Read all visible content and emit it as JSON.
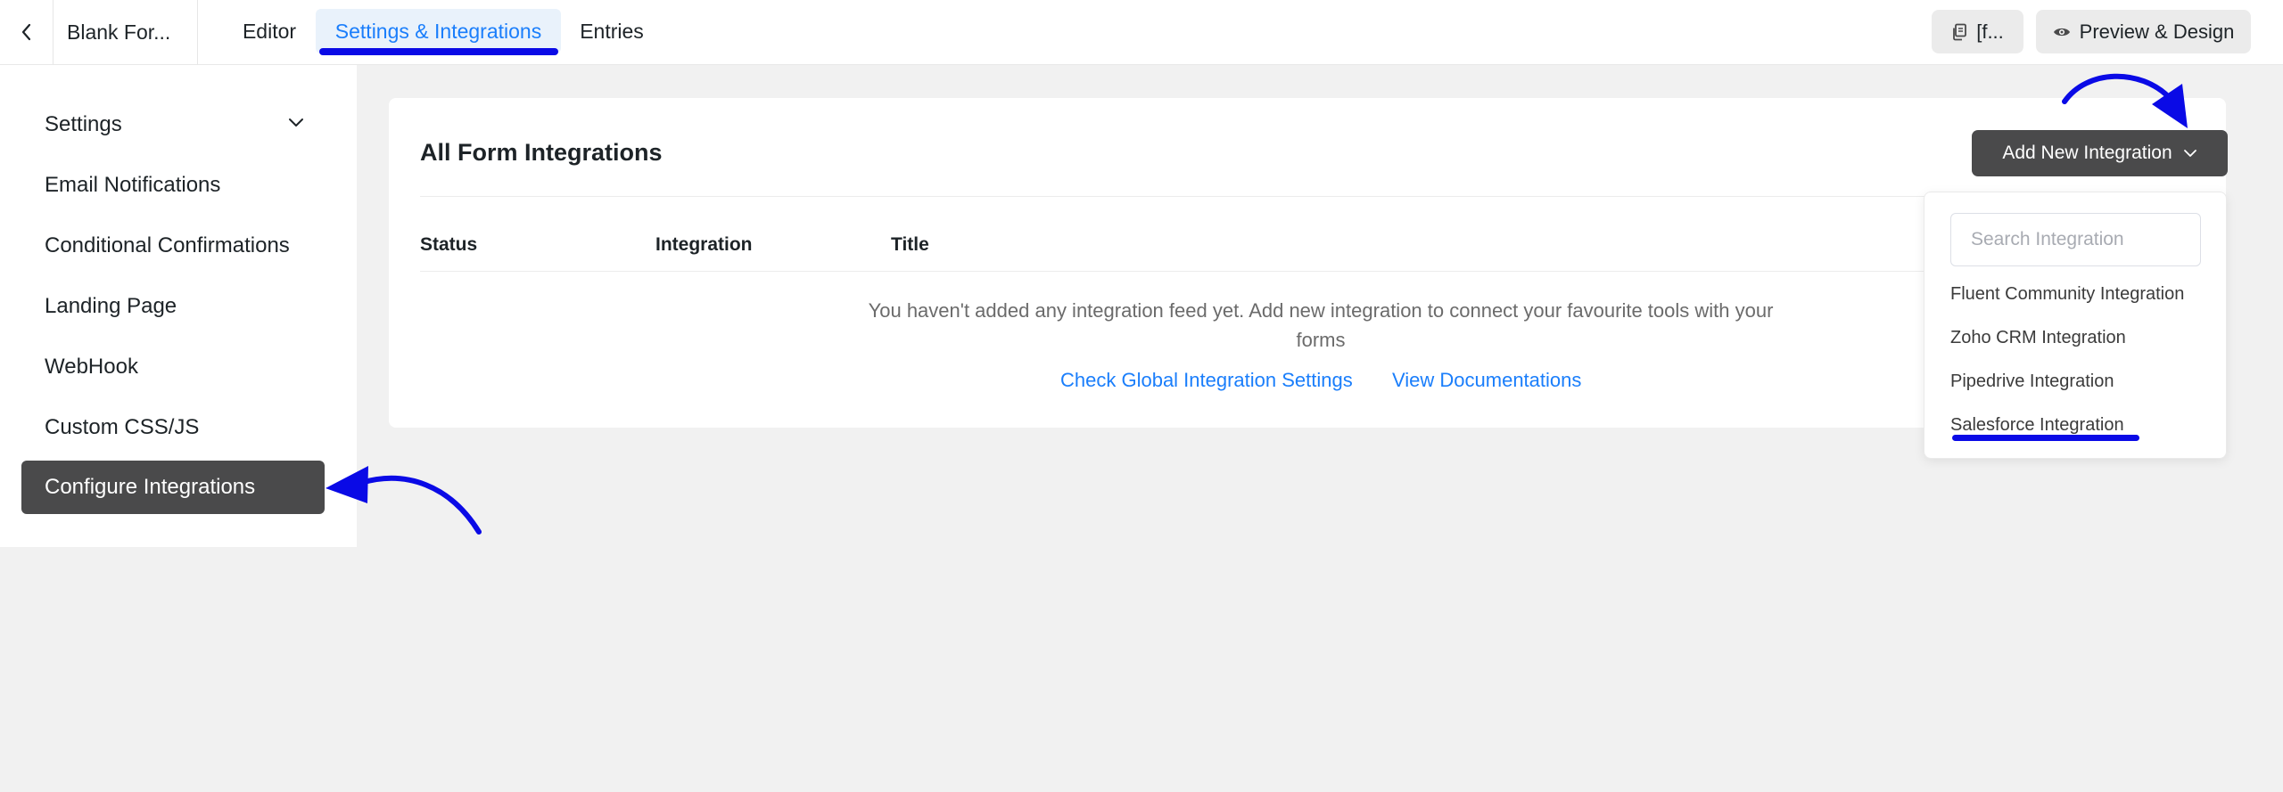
{
  "header": {
    "form_name": "Blank For...",
    "tabs": [
      {
        "label": "Editor"
      },
      {
        "label": "Settings & Integrations"
      },
      {
        "label": "Entries"
      }
    ],
    "shortcode_label": "[f...",
    "preview_label": "Preview & Design"
  },
  "sidebar": {
    "items": [
      {
        "label": "Settings"
      },
      {
        "label": "Email Notifications"
      },
      {
        "label": "Conditional Confirmations"
      },
      {
        "label": "Landing Page"
      },
      {
        "label": "WebHook"
      },
      {
        "label": "Custom CSS/JS"
      },
      {
        "label": "Configure Integrations"
      }
    ]
  },
  "main": {
    "title": "All Form Integrations",
    "columns": [
      "Status",
      "Integration",
      "Title"
    ],
    "empty_message": "You haven't added any integration feed yet. Add new integration to connect your favourite tools with your forms",
    "links": [
      "Check Global Integration Settings",
      "View Documentations"
    ],
    "add_button_label": "Add New Integration"
  },
  "dropdown": {
    "search_placeholder": "Search Integration",
    "items": [
      {
        "label": "Fluent Community Integration"
      },
      {
        "label": "Zoho CRM Integration"
      },
      {
        "label": "Pipedrive Integration"
      },
      {
        "label": "Salesforce Integration"
      }
    ]
  },
  "colors": {
    "accent": "#1a7efb",
    "active_item_bg": "#4a4a4b",
    "annotation": "#0a0ae6"
  }
}
